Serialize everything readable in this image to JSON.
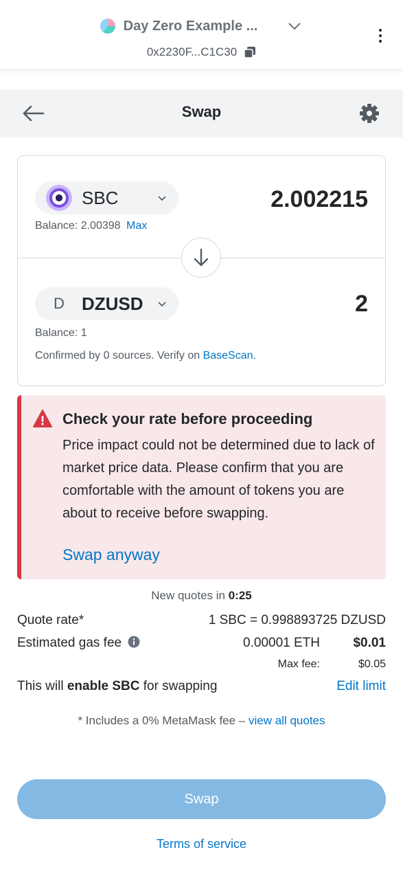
{
  "account": {
    "name": "Day Zero Example ...",
    "address": "0x2230F...C1C30"
  },
  "swap_header": {
    "title": "Swap"
  },
  "from_token": {
    "symbol": "SBC",
    "amount": "2.002215",
    "balance_label": "Balance: 2.00398",
    "max_label": "Max"
  },
  "to_token": {
    "icon_letter": "D",
    "symbol": "DZUSD",
    "amount": "2",
    "balance_label": "Balance: 1",
    "confirmed_text": "Confirmed by 0 sources. Verify on ",
    "confirmed_link": "BaseScan."
  },
  "warning": {
    "title": "Check your rate before proceeding",
    "body": "Price impact could not be determined due to lack of market price data. Please confirm that you are comfortable with the amount of tokens you are about to receive before swapping.",
    "action": "Swap anyway",
    "color": "#d73847"
  },
  "quote": {
    "new_quotes_prefix": "New quotes in ",
    "countdown": "0:25",
    "rate_label": "Quote rate*",
    "rate_value": "1 SBC = 0.998893725 DZUSD",
    "gas_label": "Estimated gas fee",
    "gas_eth": "0.00001 ETH",
    "gas_usd": "$0.01",
    "max_fee_label": "Max fee:",
    "max_fee_value": "$0.05",
    "enable_prefix": "This will ",
    "enable_bold": "enable SBC",
    "enable_suffix": " for swapping",
    "edit_limit": "Edit limit",
    "fee_note": "* Includes a 0% MetaMask fee – ",
    "fee_note_link": "view all quotes"
  },
  "actions": {
    "swap_button": "Swap",
    "terms": "Terms of service"
  },
  "colors": {
    "accent": "#0376c9",
    "swap_button_disabled": "#84b9e3",
    "warning_bg": "#f9e8ea"
  }
}
